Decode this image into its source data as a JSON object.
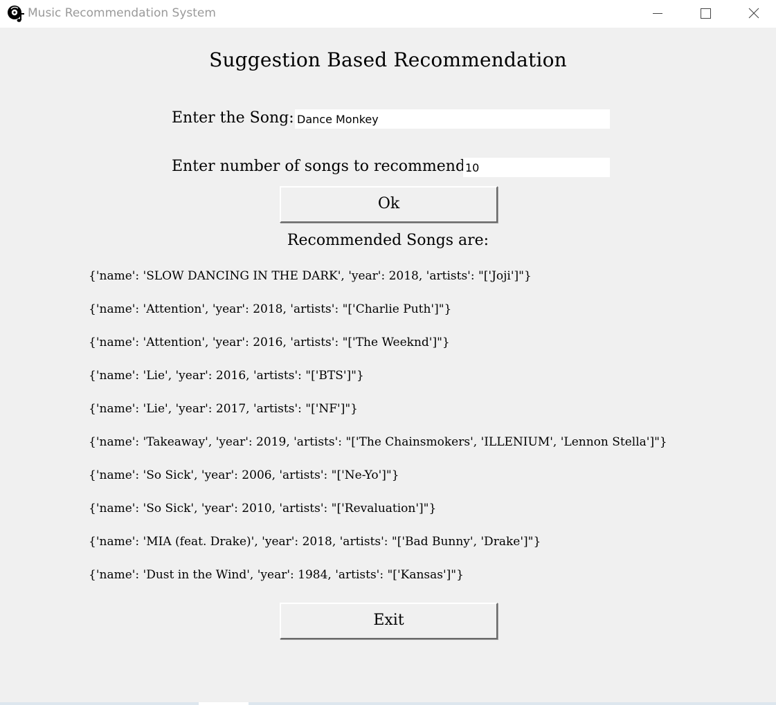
{
  "window": {
    "title": "Music Recommendation System",
    "icon": "music-disc-icon"
  },
  "heading": "Suggestion Based Recommendation",
  "form": {
    "song_label": "Enter the Song:",
    "song_value": "Dance Monkey",
    "count_label": "Enter number of songs to recommend:",
    "count_value": "10",
    "ok_label": "Ok"
  },
  "results": {
    "heading": "Recommended Songs are:",
    "items": [
      "{'name': 'SLOW DANCING IN THE DARK', 'year': 2018, 'artists': \"['Joji']\"}",
      "{'name': 'Attention', 'year': 2018, 'artists': \"['Charlie Puth']\"}",
      "{'name': 'Attention', 'year': 2016, 'artists': \"['The Weeknd']\"}",
      "{'name': 'Lie', 'year': 2016, 'artists': \"['BTS']\"}",
      "{'name': 'Lie', 'year': 2017, 'artists': \"['NF']\"}",
      "{'name': 'Takeaway', 'year': 2019, 'artists': \"['The Chainsmokers', 'ILLENIUM', 'Lennon Stella']\"}",
      "{'name': 'So Sick', 'year': 2006, 'artists': \"['Ne-Yo']\"}",
      "{'name': 'So Sick', 'year': 2010, 'artists': \"['Revaluation']\"}",
      "{'name': 'MIA (feat. Drake)', 'year': 2018, 'artists': \"['Bad Bunny', 'Drake']\"}",
      "{'name': 'Dust in the Wind', 'year': 1984, 'artists': \"['Kansas']\"}"
    ]
  },
  "exit_label": "Exit",
  "colors": {
    "window_background": "#f0f0f0",
    "titlebar_background": "#ffffff",
    "title_text": "#9a9a9a"
  }
}
